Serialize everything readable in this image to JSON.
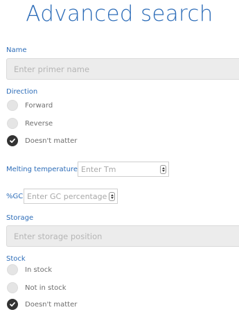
{
  "page_title": "Advanced search",
  "name": {
    "label": "Name",
    "placeholder": "Enter primer name"
  },
  "direction": {
    "label": "Direction",
    "options": [
      "Forward",
      "Reverse",
      "Doesn't matter"
    ],
    "selected": "Doesn't matter"
  },
  "melting_temperature": {
    "label": "Melting temperature",
    "placeholder": "Enter Tm"
  },
  "gc": {
    "label": "%GC",
    "placeholder": "Enter GC percentage"
  },
  "storage": {
    "label": "Storage",
    "placeholder": "Enter storage position"
  },
  "stock": {
    "label": "Stock",
    "options": [
      "In stock",
      "Not in stock",
      "Doesn't matter"
    ],
    "selected": "Doesn't matter"
  },
  "icons": {
    "radio_checked": "check-icon",
    "spinner": "spinner-icon"
  },
  "colors": {
    "accent": "#2c6cb8",
    "input_background": "#ececec",
    "radio_checked": "#333333"
  }
}
